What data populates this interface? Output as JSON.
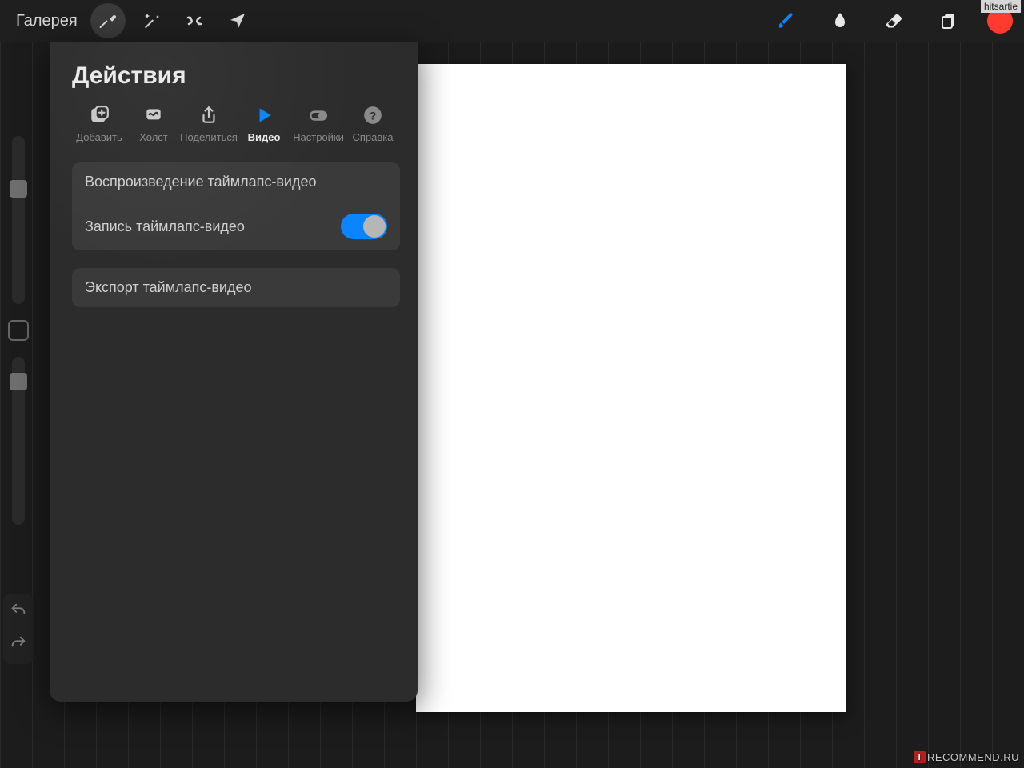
{
  "topbar": {
    "gallery_label": "Галерея",
    "left_icons": [
      "wrench-icon",
      "magic-wand-icon",
      "selection-icon",
      "move-icon"
    ],
    "right_icons": [
      "brush-icon",
      "smudge-icon",
      "eraser-icon",
      "layers-icon"
    ],
    "color_swatch": "#ff3b30",
    "brush_active_color": "#0a84ff"
  },
  "account_tag": "hitsartie",
  "side": {
    "brush_size_thumb_pct": 28,
    "opacity_thumb_pct": 12
  },
  "actions_panel": {
    "title": "Действия",
    "tabs": [
      {
        "id": "add",
        "label": "Добавить",
        "icon": "plus-square-icon",
        "active": false
      },
      {
        "id": "canvas",
        "label": "Холст",
        "icon": "canvas-icon",
        "active": false
      },
      {
        "id": "share",
        "label": "Поделиться",
        "icon": "share-icon",
        "active": false
      },
      {
        "id": "video",
        "label": "Видео",
        "icon": "play-icon",
        "active": true
      },
      {
        "id": "settings",
        "label": "Настройки",
        "icon": "gear-toggle-icon",
        "active": false
      },
      {
        "id": "help",
        "label": "Справка",
        "icon": "help-icon",
        "active": false
      }
    ],
    "groups": [
      [
        {
          "label": "Воспроизведение таймлапс-видео",
          "toggle": null
        },
        {
          "label": "Запись таймлапс-видео",
          "toggle": true
        }
      ],
      [
        {
          "label": "Экспорт таймлапс-видео",
          "toggle": null
        }
      ]
    ]
  },
  "watermark": {
    "prefix": "I",
    "text": "RECOMMEND.RU"
  }
}
